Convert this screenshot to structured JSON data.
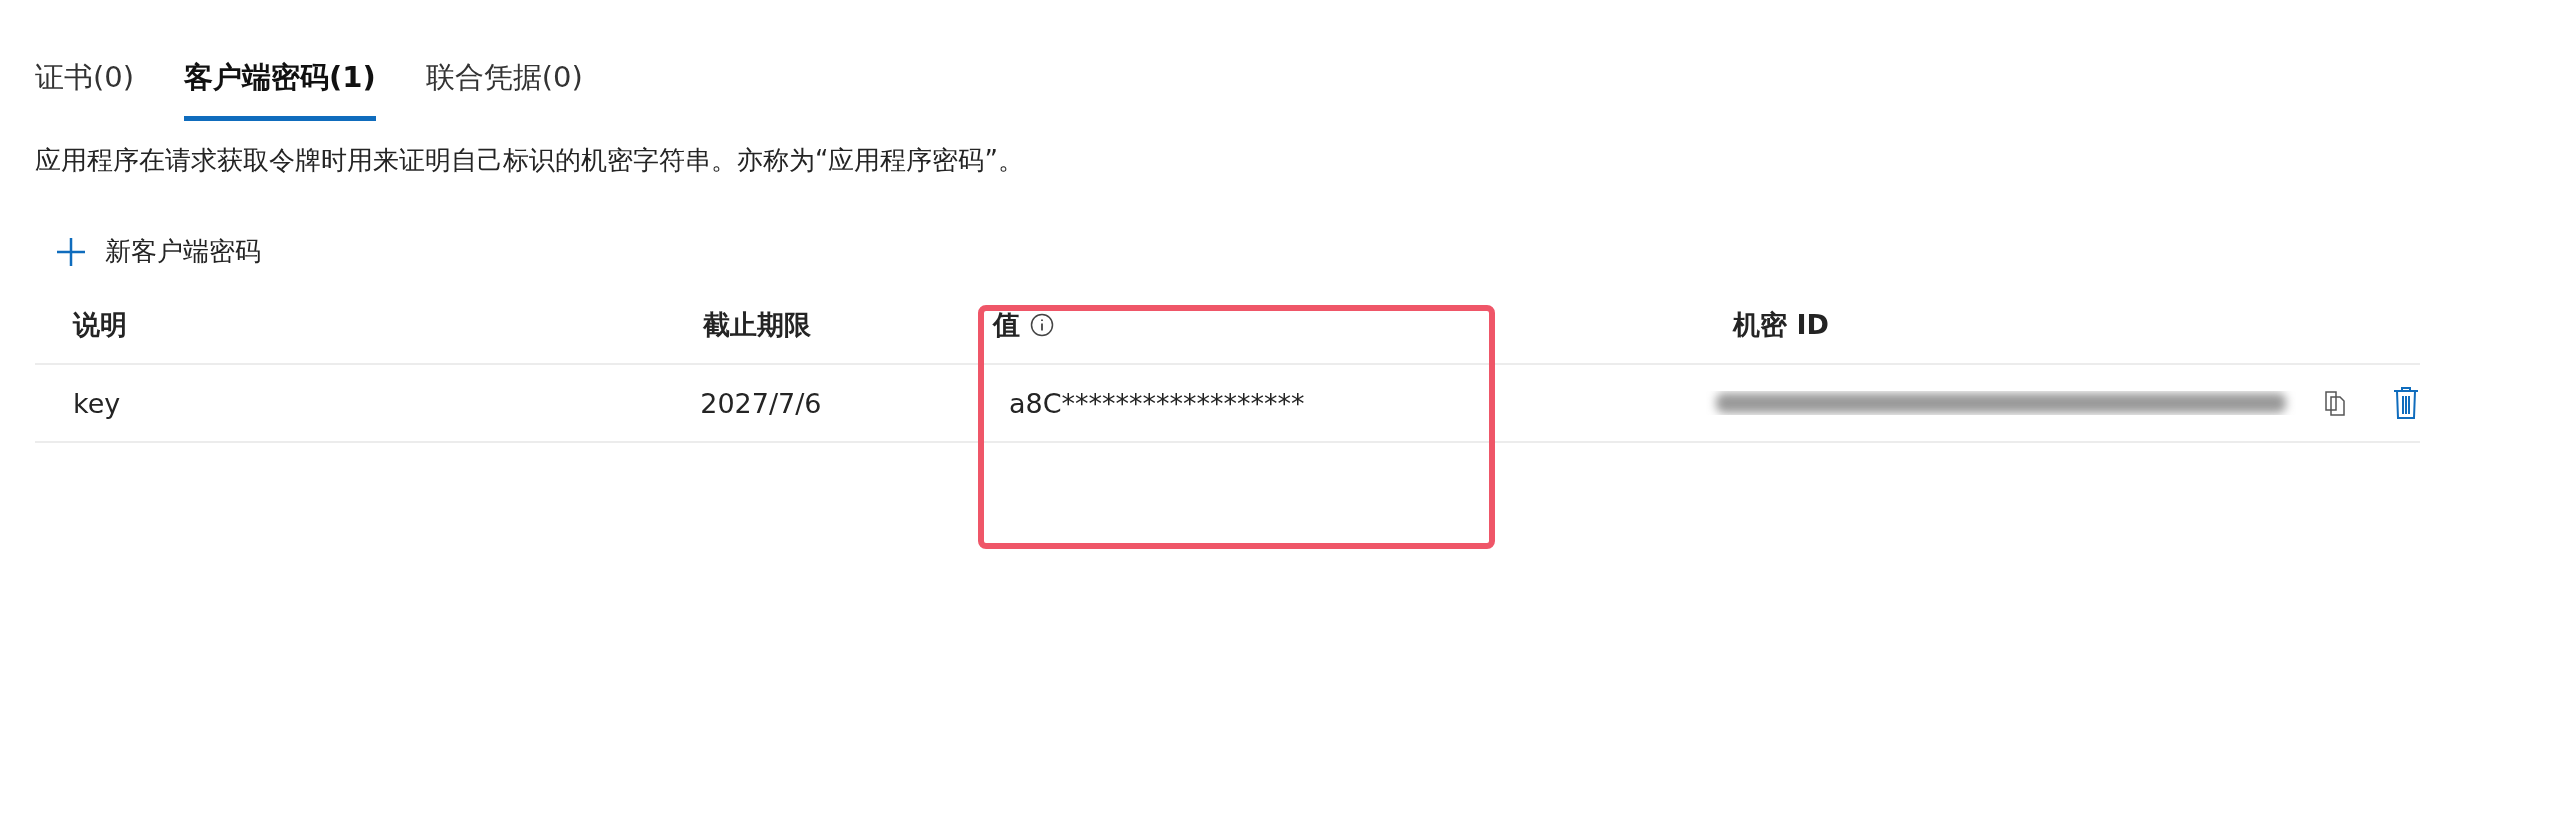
{
  "tabs": [
    {
      "label": "证书(0)",
      "selected": false
    },
    {
      "label": "客户端密码(1)",
      "selected": true
    },
    {
      "label": "联合凭据(0)",
      "selected": false
    }
  ],
  "description": "应用程序在请求获取令牌时用来证明自己标识的机密字符串。亦称为“应用程序密码”。",
  "add_button": "新客户端密码",
  "table": {
    "columns": [
      "说明",
      "截止期限",
      "值",
      "机密 ID"
    ],
    "rows": [
      {
        "description": "key",
        "expires": "2027/7/6",
        "value": "a8C******************"
      }
    ]
  },
  "annotation": {
    "kind": "highlight"
  }
}
